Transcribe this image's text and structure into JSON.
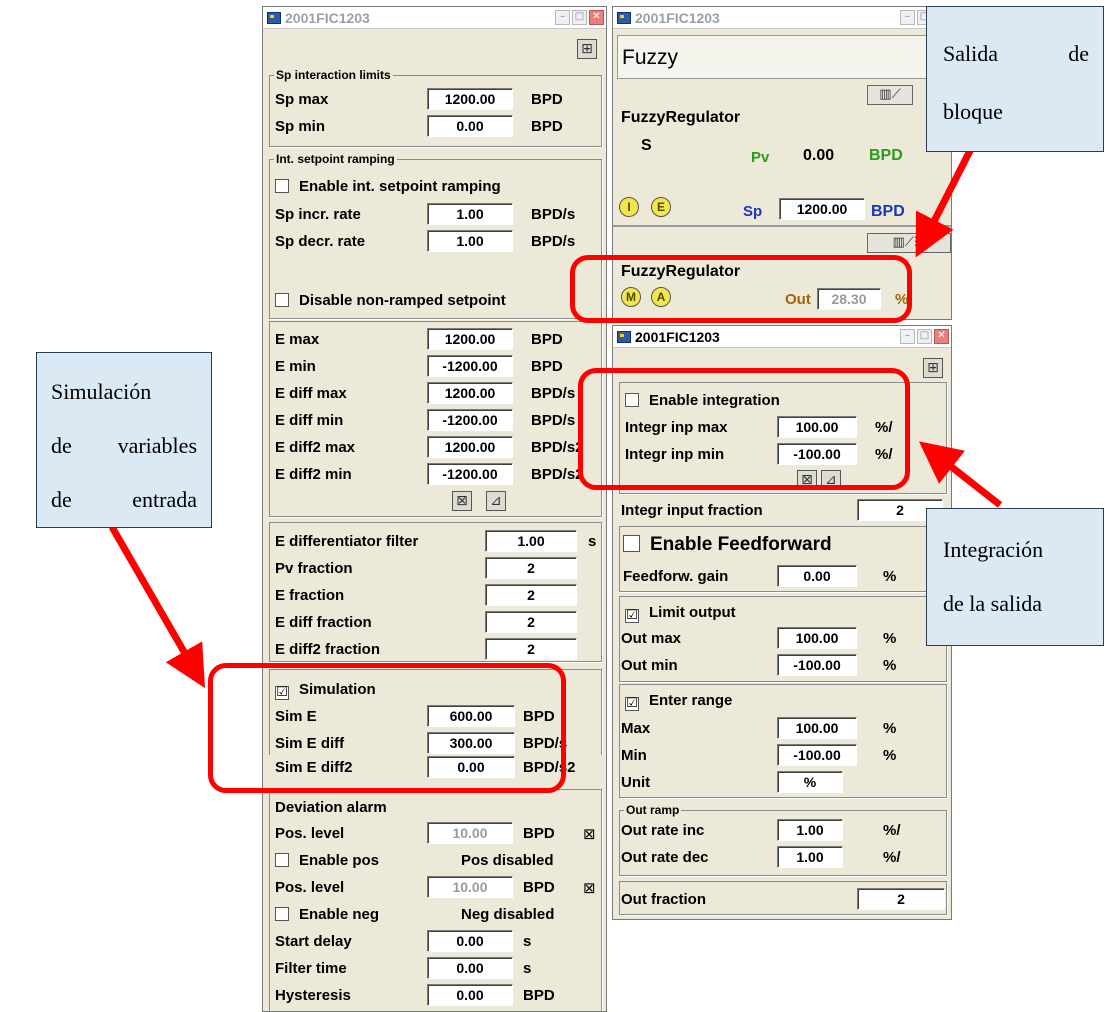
{
  "window1": {
    "title": "2001FIC1203",
    "sp_limits": {
      "group": "Sp interaction limits",
      "sp_max_label": "Sp max",
      "sp_max": "1200.00",
      "sp_max_unit": "BPD",
      "sp_min_label": "Sp min",
      "sp_min": "0.00",
      "sp_min_unit": "BPD"
    },
    "ramping": {
      "group": "Int. setpoint ramping",
      "enable_label": "Enable int. setpoint ramping",
      "incr_label": "Sp incr. rate",
      "incr": "1.00",
      "incr_unit": "BPD/s",
      "decr_label": "Sp decr. rate",
      "decr": "1.00",
      "decr_unit": "BPD/s",
      "disable_label": "Disable non-ramped setpoint"
    },
    "e_limits": {
      "rows": [
        {
          "label": "E max",
          "value": "1200.00",
          "unit": "BPD"
        },
        {
          "label": "E min",
          "value": "-1200.00",
          "unit": "BPD"
        },
        {
          "label": "E diff max",
          "value": "1200.00",
          "unit": "BPD/s"
        },
        {
          "label": "E diff min",
          "value": "-1200.00",
          "unit": "BPD/s"
        },
        {
          "label": "E diff2 max",
          "value": "1200.00",
          "unit": "BPD/s2"
        },
        {
          "label": "E diff2 min",
          "value": "-1200.00",
          "unit": "BPD/s2"
        }
      ]
    },
    "fractions": {
      "filter_label": "E differentiator filter",
      "filter": "1.00",
      "filter_unit": "s",
      "pv_label": "Pv fraction",
      "pv": "2",
      "e_label": "E fraction",
      "e": "2",
      "ediff_label": "E diff fraction",
      "ediff": "2",
      "ediff2_label": "E diff2 fraction",
      "ediff2": "2"
    },
    "simulation": {
      "label": "Simulation",
      "checked": "☑",
      "sim_e_label": "Sim E",
      "sim_e": "600.00",
      "sim_e_unit": "BPD",
      "sim_ediff_label": "Sim E diff",
      "sim_ediff": "300.00",
      "sim_ediff_unit": "BPD/s",
      "sim_ediff2_label": "Sim E diff2",
      "sim_ediff2": "0.00",
      "sim_ediff2_unit": "BPD/s2"
    },
    "deviation": {
      "title": "Deviation alarm",
      "pos_level_label": "Pos. level",
      "pos_level": "10.00",
      "pos_level_unit": "BPD",
      "enable_pos_label": "Enable pos",
      "pos_status": "Pos disabled",
      "pos_level2_label": "Pos. level",
      "pos_level2": "10.00",
      "pos_level2_unit": "BPD",
      "enable_neg_label": "Enable neg",
      "neg_status": "Neg disabled",
      "start_delay_label": "Start delay",
      "start_delay": "0.00",
      "start_delay_unit": "s",
      "filter_time_label": "Filter time",
      "filter_time": "0.00",
      "filter_time_unit": "s",
      "hysteresis_label": "Hysteresis",
      "hysteresis": "0.00",
      "hysteresis_unit": "BPD"
    }
  },
  "window2": {
    "title": "2001FIC1203",
    "header": "Fuzzy",
    "block1": {
      "name": "FuzzyRegulator",
      "s": "S",
      "pv_label": "Pv",
      "pv_value": "0.00",
      "pv_unit": "BPD",
      "sp_label": "Sp",
      "sp_value": "1200.00",
      "sp_unit": "BPD"
    },
    "block2": {
      "name": "FuzzyRegulator",
      "out_label": "Out",
      "out_value": "28.30",
      "out_unit": "%"
    }
  },
  "window3": {
    "title": "2001FIC1203",
    "integration": {
      "enable_label": "Enable integration",
      "max_label": "Integr inp max",
      "max": "100.00",
      "max_unit": "%/",
      "min_label": "Integr inp min",
      "min": "-100.00",
      "min_unit": "%/"
    },
    "integr_fraction_label": "Integr input fraction",
    "integr_fraction": "2",
    "feedforward": {
      "enable_label": "Enable Feedforward",
      "gain_label": "Feedforw. gain",
      "gain": "0.00",
      "gain_unit": "%"
    },
    "limit": {
      "label": "Limit output",
      "checked": "☑",
      "max_label": "Out max",
      "max": "100.00",
      "max_unit": "%",
      "min_label": "Out min",
      "min": "-100.00",
      "min_unit": "%"
    },
    "range": {
      "label": "Enter range",
      "checked": "☑",
      "max_label": "Max",
      "max": "100.00",
      "max_unit": "%",
      "min_label": "Min",
      "min": "-100.00",
      "min_unit": "%",
      "unit_label": "Unit",
      "unit": "%"
    },
    "ramp": {
      "group": "Out ramp",
      "inc_label": "Out rate inc",
      "inc": "1.00",
      "inc_unit": "%/",
      "dec_label": "Out rate dec",
      "dec": "1.00",
      "dec_unit": "%/"
    },
    "out_fraction_label": "Out fraction",
    "out_fraction": "2"
  },
  "callouts": {
    "salida": {
      "line1": "Salida",
      "line1b": "de",
      "line2": "bloque"
    },
    "simulacion": {
      "line1": "Simulación",
      "line2a": "de",
      "line2b": "variables",
      "line3a": "de",
      "line3b": "entrada"
    },
    "integracion": {
      "line1": "Integración",
      "line2": "de la salida"
    }
  },
  "colors": {
    "highlight": "#ff0000",
    "callout_bg": "#dbe9f5",
    "pv_green": "#2a9a1a",
    "sp_blue": "#1838b8",
    "out_brown": "#a8620a"
  }
}
